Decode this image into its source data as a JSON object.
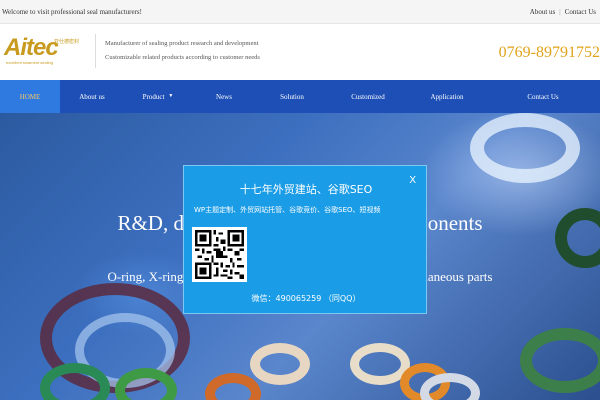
{
  "topbar": {
    "welcome": "Welcome to visit professional seal manufacturers!",
    "links": [
      "About us",
      "Contact Us"
    ]
  },
  "header": {
    "logo": {
      "main": "Aitec",
      "cn": "亚仕德密封",
      "sub": "excellent sinament sealing"
    },
    "tagline1": "Manufacturer of sealing product research and development",
    "tagline2": "Customizable related products according to customer needs",
    "phone": "0769-89791752"
  },
  "nav": {
    "items": [
      {
        "label": "HOME",
        "active": true
      },
      {
        "label": "About us"
      },
      {
        "label": "Product",
        "caret": "▼"
      },
      {
        "label": "News"
      },
      {
        "label": "Solution"
      },
      {
        "label": "Customized"
      },
      {
        "label": "Application"
      },
      {
        "label": "Contact Us"
      }
    ]
  },
  "hero": {
    "title": "R&D, design of rubber sealing components",
    "subtitle": "O-ring, X-ring (star ring), WASHER (washer), rubber miscellaneous parts"
  },
  "popup": {
    "close": "X",
    "title": "十七年外贸建站、谷歌SEO",
    "services": "WP主题定制、外贸网站托管、谷歌竞价、谷歌SEO、短视频",
    "wechat": "微信：490065259 （同QQ）"
  },
  "colors": {
    "nav_bg": "#1d4fb6",
    "nav_active": "#2f7ae0",
    "brand_gold": "#c89b1f",
    "phone": "#e0a31c",
    "popup_bg": "#1b9ce6"
  }
}
